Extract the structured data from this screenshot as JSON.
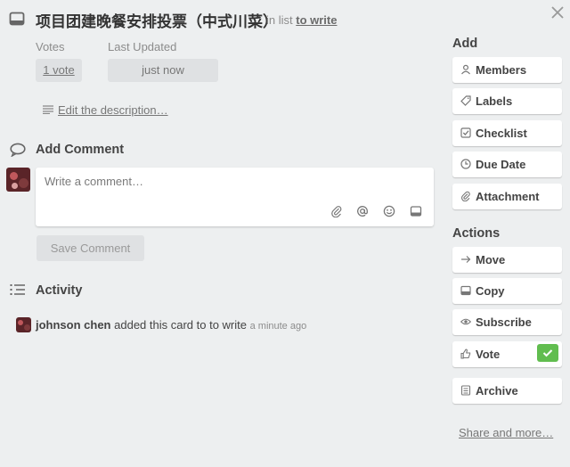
{
  "card": {
    "title": "项目团建晚餐安排投票（中式川菜）",
    "in_list_prefix": "in list",
    "list_name": "to write"
  },
  "votes": {
    "label": "Votes",
    "value": "1 vote"
  },
  "last_updated": {
    "label": "Last Updated",
    "value": "just now"
  },
  "description": {
    "link": "Edit the description…"
  },
  "comment": {
    "title": "Add Comment",
    "placeholder": "Write a comment…",
    "save_label": "Save Comment"
  },
  "activity": {
    "title": "Activity",
    "entries": [
      {
        "user": "johnson chen",
        "text": "added this card to to write",
        "time": "a minute ago"
      }
    ]
  },
  "sidebar": {
    "add_title": "Add",
    "add_items": [
      {
        "label": "Members",
        "icon": "person-icon"
      },
      {
        "label": "Labels",
        "icon": "tag-icon"
      },
      {
        "label": "Checklist",
        "icon": "checkbox-icon"
      },
      {
        "label": "Due Date",
        "icon": "clock-icon"
      },
      {
        "label": "Attachment",
        "icon": "paperclip-icon"
      }
    ],
    "actions_title": "Actions",
    "action_items": [
      {
        "label": "Move",
        "icon": "arrow-right-icon"
      },
      {
        "label": "Copy",
        "icon": "card-icon"
      },
      {
        "label": "Subscribe",
        "icon": "eye-icon"
      },
      {
        "label": "Vote",
        "icon": "thumbs-up-icon",
        "voted": true
      },
      {
        "label": "Archive",
        "icon": "archive-icon"
      }
    ],
    "share_link": "Share and more…"
  },
  "colors": {
    "background": "#edeff0",
    "vote_check": "#61bd4f",
    "avatar": "#5a2428"
  }
}
